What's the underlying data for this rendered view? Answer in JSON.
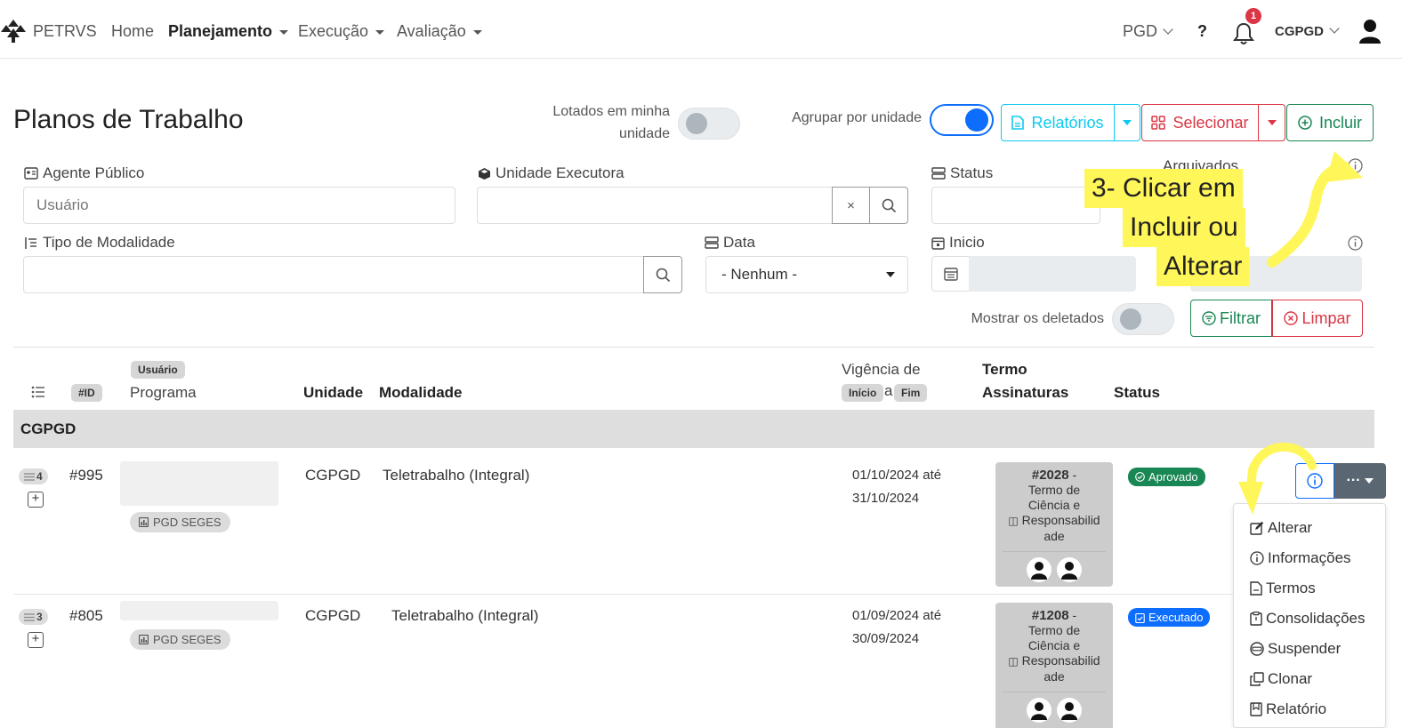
{
  "navbar": {
    "brand": "PETRVS",
    "links": [
      {
        "label": "Home"
      },
      {
        "label": "Planejamento"
      },
      {
        "label": "Execução"
      },
      {
        "label": "Avaliação"
      }
    ],
    "pgd_label": "PGD",
    "help_label": "?",
    "notifications_count": "1",
    "unit_label": "CGPGD"
  },
  "header": {
    "title": "Planos de Trabalho",
    "toggle_lotados_line1": "Lotados em minha",
    "toggle_lotados_line2": "unidade",
    "toggle_agrupar": "Agrupar por unidade",
    "btn_relatorios": "Relatórios",
    "btn_selecionar": "Selecionar",
    "btn_incluir": "Incluir"
  },
  "filters": {
    "agente_label": "Agente Público",
    "agente_placeholder": "Usuário",
    "unidade_label": "Unidade Executora",
    "clear_symbol": "×",
    "status_label": "Status",
    "arquivados_label": "Arquivados",
    "modalidade_label": "Tipo de Modalidade",
    "data_label": "Data",
    "data_value": "- Nenhum -",
    "inicio_label": "Inicio",
    "mostrar_deletados": "Mostrar os deletados",
    "btn_filtrar": "Filtrar",
    "btn_limpar": "Limpar"
  },
  "table": {
    "badge_id": "#ID",
    "badge_usuario": "Usuário",
    "col_programa": "Programa",
    "col_unidade": "Unidade",
    "col_modalidade": "Modalidade",
    "col_vigencia": "Vigência de",
    "badge_inicio": "Início",
    "vigencia_a": "a",
    "badge_fim": "Fim",
    "col_termo": "Termo",
    "col_assinaturas": "Assinaturas",
    "col_status": "Status",
    "group": "CGPGD",
    "rows": [
      {
        "count": "4",
        "id": "#995",
        "programa": "PGD SEGES",
        "unidade": "CGPGD",
        "modalidade": "Teletrabalho (Integral)",
        "vigencia_inicio": "01/10/2024 até",
        "vigencia_fim": "31/10/2024",
        "termo_id": "#2028",
        "termo_sep": " -",
        "termo_lines": [
          "Termo de",
          "Ciência e",
          "Responsabilid",
          "ade"
        ],
        "status": "Aprovado"
      },
      {
        "count": "3",
        "id": "#805",
        "programa": "PGD SEGES",
        "unidade": "CGPGD",
        "modalidade": "Teletrabalho (Integral)",
        "vigencia_inicio": "01/09/2024 até",
        "vigencia_fim": "30/09/2024",
        "termo_id": "#1208",
        "termo_sep": " -",
        "termo_lines": [
          "Termo de",
          "Ciência e",
          "Responsabilid",
          "ade"
        ],
        "status": "Executado"
      }
    ]
  },
  "row_actions": {
    "more_label": "···",
    "menu": [
      "Alterar",
      "Informações",
      "Termos",
      "Consolidações",
      "Suspender",
      "Clonar",
      "Relatório"
    ]
  },
  "annotation": {
    "line1": "3- Clicar em",
    "line2": "Incluir ou",
    "line3": "Alterar"
  },
  "colors": {
    "primary": "#0d6efd",
    "info": "#0dcaf0",
    "danger": "#dc3545",
    "success": "#198754",
    "highlight": "#fff65a"
  }
}
